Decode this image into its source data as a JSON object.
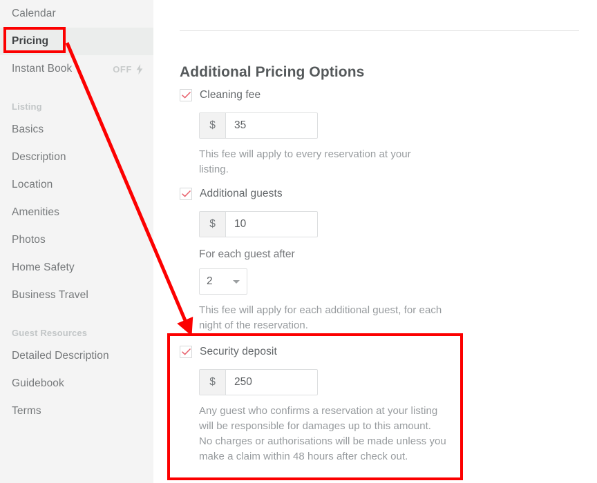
{
  "sidebar": {
    "items": [
      {
        "label": "Calendar",
        "type": "link",
        "active": false
      },
      {
        "label": "Pricing",
        "type": "link",
        "active": true
      },
      {
        "label": "Instant Book",
        "type": "link",
        "active": false,
        "status": "OFF",
        "status_icon": "bolt-icon"
      }
    ],
    "sections": [
      {
        "heading": "Listing",
        "items": [
          {
            "label": "Basics"
          },
          {
            "label": "Description"
          },
          {
            "label": "Location"
          },
          {
            "label": "Amenities"
          },
          {
            "label": "Photos"
          },
          {
            "label": "Home Safety"
          },
          {
            "label": "Business Travel"
          }
        ]
      },
      {
        "heading": "Guest Resources",
        "items": [
          {
            "label": "Detailed Description"
          },
          {
            "label": "Guidebook"
          },
          {
            "label": "Terms"
          }
        ]
      }
    ]
  },
  "main": {
    "section_title": "Additional Pricing Options",
    "options": [
      {
        "id": "cleaning-fee",
        "label": "Cleaning fee",
        "checked": true,
        "checkbox_icon": "check-icon",
        "currency_symbol": "$",
        "value": "35",
        "help": "This fee will apply to every reservation at your listing."
      },
      {
        "id": "additional-guests",
        "label": "Additional guests",
        "checked": true,
        "checkbox_icon": "check-icon",
        "currency_symbol": "$",
        "value": "10",
        "sub_label": "For each guest after",
        "select_value": "2",
        "select_icon": "chevron-down-icon",
        "help": "This fee will apply for each additional guest, for each night of the reservation."
      },
      {
        "id": "security-deposit",
        "label": "Security deposit",
        "checked": true,
        "checkbox_icon": "check-icon",
        "currency_symbol": "$",
        "value": "250",
        "help": "Any guest who confirms a reservation at your listing will be responsible for damages up to this amount. No charges or authorisations will be made unless you make a claim within 48 hours after check out."
      }
    ]
  },
  "annotations": {
    "color": "#fc0000",
    "highlight_boxes": [
      {
        "target": "Pricing"
      },
      {
        "target": "Security deposit"
      }
    ],
    "arrow": {
      "from": "Pricing",
      "to": "Security deposit"
    }
  }
}
